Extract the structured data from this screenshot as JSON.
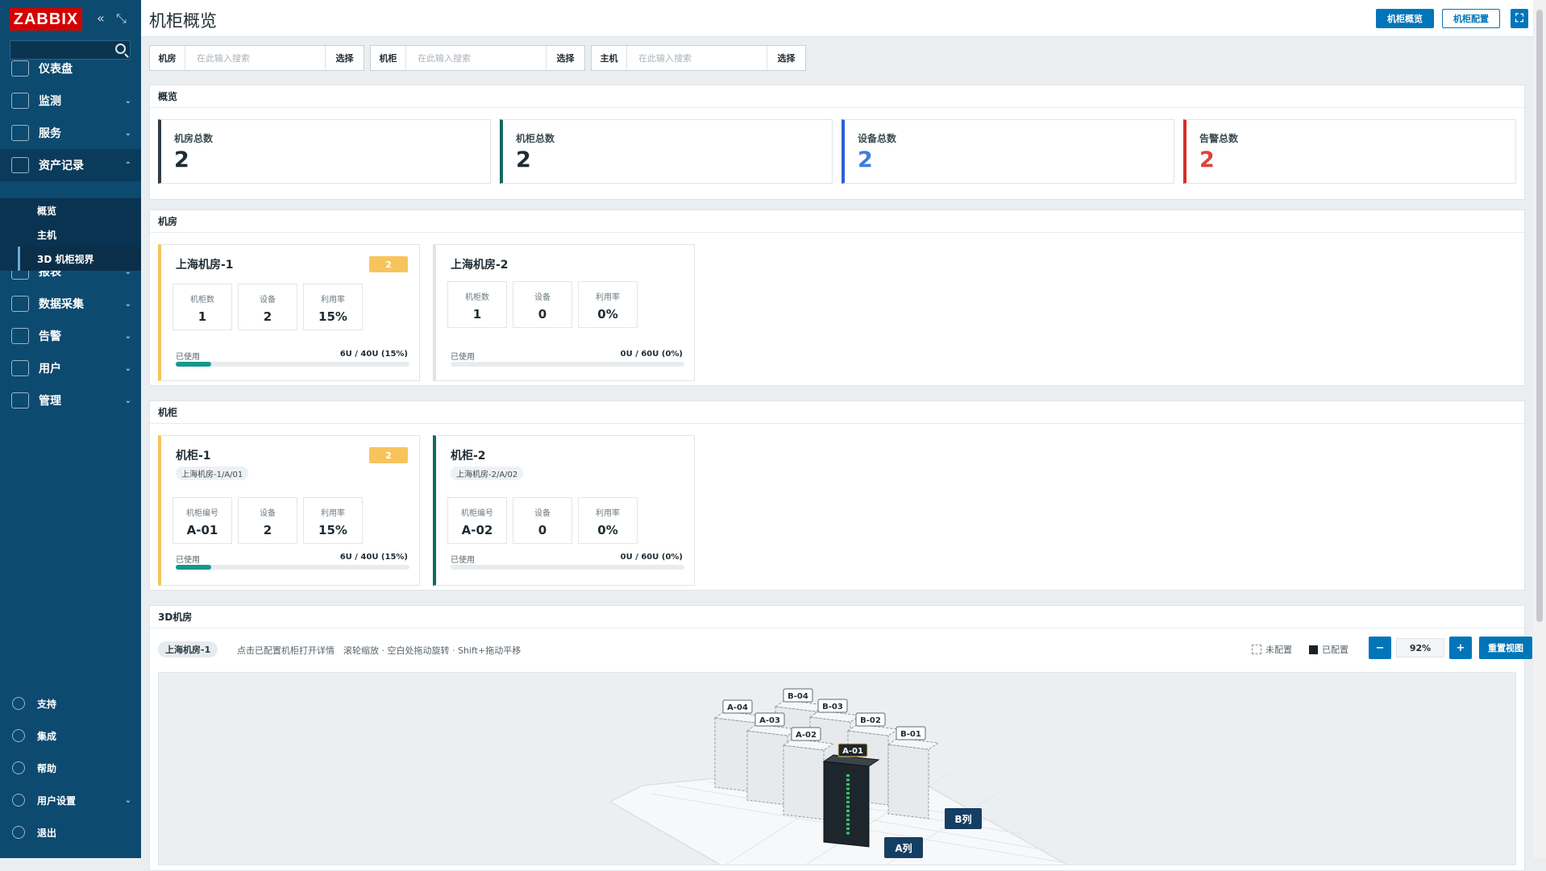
{
  "sidebar": {
    "logo": "ZABBIX",
    "menu": [
      {
        "label": "仪表盘",
        "icon": "dashboard-icon",
        "chev": ""
      },
      {
        "label": "监测",
        "icon": "monitoring-icon",
        "chev": "⌄"
      },
      {
        "label": "服务",
        "icon": "services-icon",
        "chev": "⌄"
      },
      {
        "label": "资产记录",
        "icon": "inventory-icon",
        "chev": "⌃"
      },
      {
        "label": "报表",
        "icon": "reports-icon",
        "chev": "⌄"
      },
      {
        "label": "数据采集",
        "icon": "data-collection-icon",
        "chev": "⌄"
      },
      {
        "label": "告警",
        "icon": "alerts-icon",
        "chev": "⌄"
      },
      {
        "label": "用户",
        "icon": "users-icon",
        "chev": "⌄"
      },
      {
        "label": "管理",
        "icon": "administration-icon",
        "chev": "⌄"
      }
    ],
    "submenu": [
      "概览",
      "主机",
      "3D 机柜视界"
    ],
    "bottom": [
      {
        "label": "支持",
        "icon": "support-icon",
        "chev": ""
      },
      {
        "label": "集成",
        "icon": "integrations-icon",
        "chev": ""
      },
      {
        "label": "帮助",
        "icon": "help-icon",
        "chev": ""
      },
      {
        "label": "用户设置",
        "icon": "user-settings-icon",
        "chev": "⌄"
      },
      {
        "label": "退出",
        "icon": "sign-out-icon",
        "chev": ""
      }
    ]
  },
  "header": {
    "title": "机柜概览",
    "btn_overview": "机柜概览",
    "btn_config": "机柜配置",
    "fullscreen": "⛶"
  },
  "filters": [
    {
      "label": "机房",
      "placeholder": "在此输入搜索",
      "button": "选择"
    },
    {
      "label": "机柜",
      "placeholder": "在此输入搜索",
      "button": "选择"
    },
    {
      "label": "主机",
      "placeholder": "在此输入搜索",
      "button": "选择"
    }
  ],
  "overview": {
    "title": "概览",
    "stats": [
      {
        "label": "机房总数",
        "value": "2",
        "color": "#1f2c33",
        "border": "#2d3e48"
      },
      {
        "label": "机柜总数",
        "value": "2",
        "color": "#1f2c33",
        "border": "#0f6b61"
      },
      {
        "label": "设备总数",
        "value": "2",
        "color": "#3d7de0",
        "border": "#2f5fd6"
      },
      {
        "label": "告警总数",
        "value": "2",
        "color": "#e0413c",
        "border": "#d4302c"
      }
    ]
  },
  "rooms": {
    "title": "机房",
    "items": [
      {
        "name": "上海机房-1",
        "badge": "2",
        "m1l": "机柜数",
        "m1v": "1",
        "m2l": "设备",
        "m2v": "2",
        "m3l": "利用率",
        "m3v": "15%",
        "used": "已使用",
        "usage": "6U / 40U (15%)",
        "pct": 0.15,
        "border": "#f7c45c"
      },
      {
        "name": "上海机房-2",
        "badge": "",
        "m1l": "机柜数",
        "m1v": "1",
        "m2l": "设备",
        "m2v": "0",
        "m3l": "利用率",
        "m3v": "0%",
        "used": "已使用",
        "usage": "0U / 60U (0%)",
        "pct": 0,
        "border": "#dfe4e7"
      }
    ]
  },
  "cabinets": {
    "title": "机柜",
    "items": [
      {
        "name": "机柜-1",
        "badge": "2",
        "path": "上海机房-1/A/01",
        "m1l": "机柜编号",
        "m1v": "A-01",
        "m2l": "设备",
        "m2v": "2",
        "m3l": "利用率",
        "m3v": "15%",
        "used": "已使用",
        "usage": "6U / 40U (15%)",
        "pct": 0.15,
        "border": "#f7c45c"
      },
      {
        "name": "机柜-2",
        "badge": "",
        "path": "上海机房-2/A/02",
        "m1l": "机柜编号",
        "m1v": "A-02",
        "m2l": "设备",
        "m2v": "0",
        "m3l": "利用率",
        "m3v": "0%",
        "used": "已使用",
        "usage": "0U / 60U (0%)",
        "pct": 0,
        "border": "#0f6b61"
      }
    ]
  },
  "scene3d": {
    "title": "3D机房",
    "room_pill": "上海机房-1",
    "hint": "点击已配置机柜打开详情　滚轮缩放 · 空白处拖动旋转 · Shift+拖动平移",
    "legend_unconfigured": "未配置",
    "legend_configured": "已配置",
    "zoom_out": "−",
    "zoom": "92%",
    "zoom_in": "+",
    "reset": "重置视图",
    "racks": [
      {
        "label": "B-04"
      },
      {
        "label": "A-04"
      },
      {
        "label": "B-03"
      },
      {
        "label": "A-03"
      },
      {
        "label": "B-02"
      },
      {
        "label": "A-02"
      },
      {
        "label": "B-01"
      },
      {
        "label": "A-01"
      }
    ],
    "row_a": "A列",
    "row_b": "B列"
  }
}
